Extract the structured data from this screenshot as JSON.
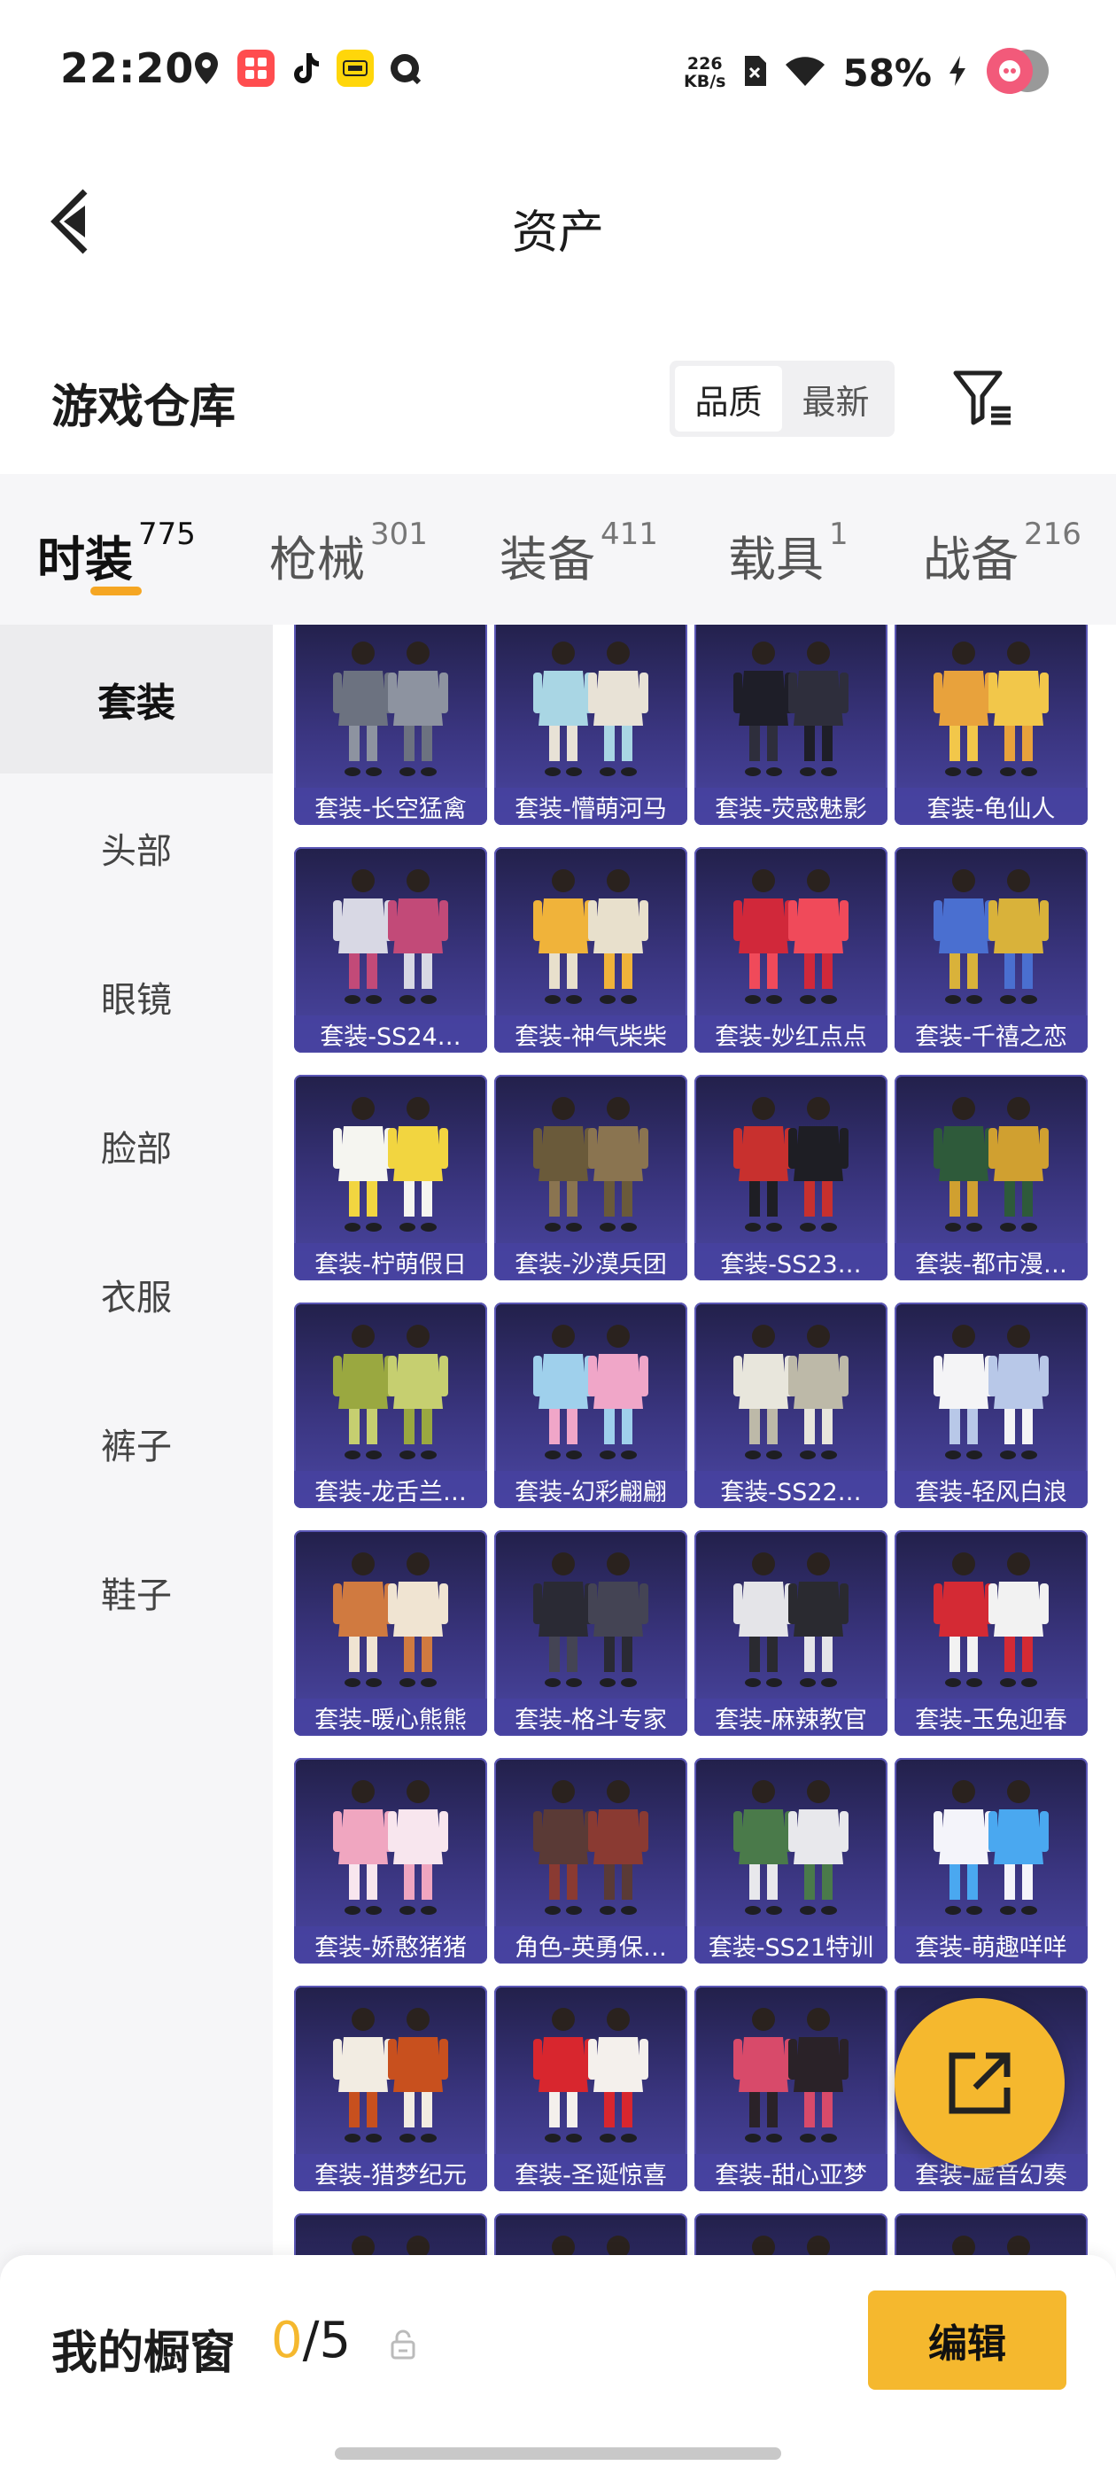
{
  "status_bar": {
    "time": "22:20",
    "net_speed_value": "226",
    "net_speed_unit": "KB/s",
    "battery": "58%",
    "app_icons": [
      "location-icon",
      "xiaohongshu-icon",
      "tiktok-icon",
      "meituan-icon",
      "quark-icon"
    ]
  },
  "header": {
    "title": "资产"
  },
  "section": {
    "title": "游戏仓库",
    "sort_options": [
      "品质",
      "最新"
    ],
    "sort_selected": "品质"
  },
  "tabs": [
    {
      "label": "时装",
      "count": "775"
    },
    {
      "label": "枪械",
      "count": "301"
    },
    {
      "label": "装备",
      "count": "411"
    },
    {
      "label": "载具",
      "count": "1"
    },
    {
      "label": "战备",
      "count": "216"
    }
  ],
  "sidebar": [
    {
      "label": "套装"
    },
    {
      "label": "头部"
    },
    {
      "label": "眼镜"
    },
    {
      "label": "脸部"
    },
    {
      "label": "衣服"
    },
    {
      "label": "裤子"
    },
    {
      "label": "鞋子"
    }
  ],
  "items": [
    {
      "name": "套装-长空猛禽",
      "palette": [
        "#6c7280",
        "#8d93a0"
      ]
    },
    {
      "name": "套装-懵萌河马",
      "palette": [
        "#a9d6e4",
        "#e8e2d6"
      ]
    },
    {
      "name": "套装-荧惑魅影",
      "palette": [
        "#1e1e28",
        "#2e2e3c"
      ]
    },
    {
      "name": "套装-龟仙人",
      "palette": [
        "#e8a23c",
        "#f2c74a"
      ]
    },
    {
      "name": "套装-SS24…",
      "palette": [
        "#d8d8e4",
        "#c24a78"
      ]
    },
    {
      "name": "套装-神气柴柴",
      "palette": [
        "#f0b33a",
        "#e8e0cc"
      ]
    },
    {
      "name": "套装-妙红点点",
      "palette": [
        "#d1283a",
        "#f04a5a"
      ]
    },
    {
      "name": "套装-千禧之恋",
      "palette": [
        "#4a6fd0",
        "#d9b23a"
      ]
    },
    {
      "name": "套装-柠萌假日",
      "palette": [
        "#f5f5f0",
        "#f2d540"
      ]
    },
    {
      "name": "套装-沙漠兵团",
      "palette": [
        "#6a5a3a",
        "#8a7450"
      ]
    },
    {
      "name": "套装-SS23…",
      "palette": [
        "#c8302e",
        "#1e1e24"
      ]
    },
    {
      "name": "套装-都市漫…",
      "palette": [
        "#2e5a3a",
        "#d0a030"
      ]
    },
    {
      "name": "套装-龙舌兰…",
      "palette": [
        "#9aa840",
        "#c6cf70"
      ]
    },
    {
      "name": "套装-幻彩翩翩",
      "palette": [
        "#9fd0ec",
        "#f0a6c8"
      ]
    },
    {
      "name": "套装-SS22…",
      "palette": [
        "#e8e6dc",
        "#bdb9a8"
      ]
    },
    {
      "name": "套装-轻风白浪",
      "palette": [
        "#f4f4f6",
        "#b8c8e8"
      ]
    },
    {
      "name": "套装-暖心熊熊",
      "palette": [
        "#d07a40",
        "#f0e4d2"
      ]
    },
    {
      "name": "套装-格斗专家",
      "palette": [
        "#2a2a34",
        "#444454"
      ]
    },
    {
      "name": "套装-麻辣教官",
      "palette": [
        "#e4e4e8",
        "#2a2a30"
      ]
    },
    {
      "name": "套装-玉兔迎春",
      "palette": [
        "#d42a34",
        "#f2f2f2"
      ]
    },
    {
      "name": "套装-娇憨猪猪",
      "palette": [
        "#f0a6c0",
        "#f8e6ee"
      ]
    },
    {
      "name": "角色-英勇保…",
      "palette": [
        "#5a3a36",
        "#8a3a32"
      ]
    },
    {
      "name": "套装-SS21特训",
      "palette": [
        "#4a7a4a",
        "#e8e8ec"
      ]
    },
    {
      "name": "套装-萌趣咩咩",
      "palette": [
        "#f4f4fa",
        "#4aa8f0"
      ]
    },
    {
      "name": "套装-猎梦纪元",
      "palette": [
        "#f2ece2",
        "#c8501e"
      ]
    },
    {
      "name": "套装-圣诞惊喜",
      "palette": [
        "#d8262e",
        "#f4f0ec"
      ]
    },
    {
      "name": "套装-甜心亚梦",
      "palette": [
        "#d84a6a",
        "#2a2228"
      ]
    },
    {
      "name": "套装-虚音幻奏",
      "palette": [
        "#3a3a5a",
        "#8a7ac0"
      ]
    },
    {
      "name": "",
      "palette": [
        "#8a2a5a",
        "#3a2a4a"
      ]
    },
    {
      "name": "",
      "palette": [
        "#6a6a6a",
        "#4a4a4a"
      ]
    },
    {
      "name": "",
      "palette": [
        "#e8d8c8",
        "#c8a888"
      ]
    },
    {
      "name": "",
      "palette": [
        "#b06ad0",
        "#6a4a8a"
      ]
    }
  ],
  "fab": {
    "icon": "share-external-icon"
  },
  "showcase": {
    "title": "我的橱窗",
    "current": "0",
    "total": "/5",
    "edit_label": "编辑"
  },
  "colors": {
    "accent": "#f5b82e",
    "card_bg": "#3a3580"
  }
}
